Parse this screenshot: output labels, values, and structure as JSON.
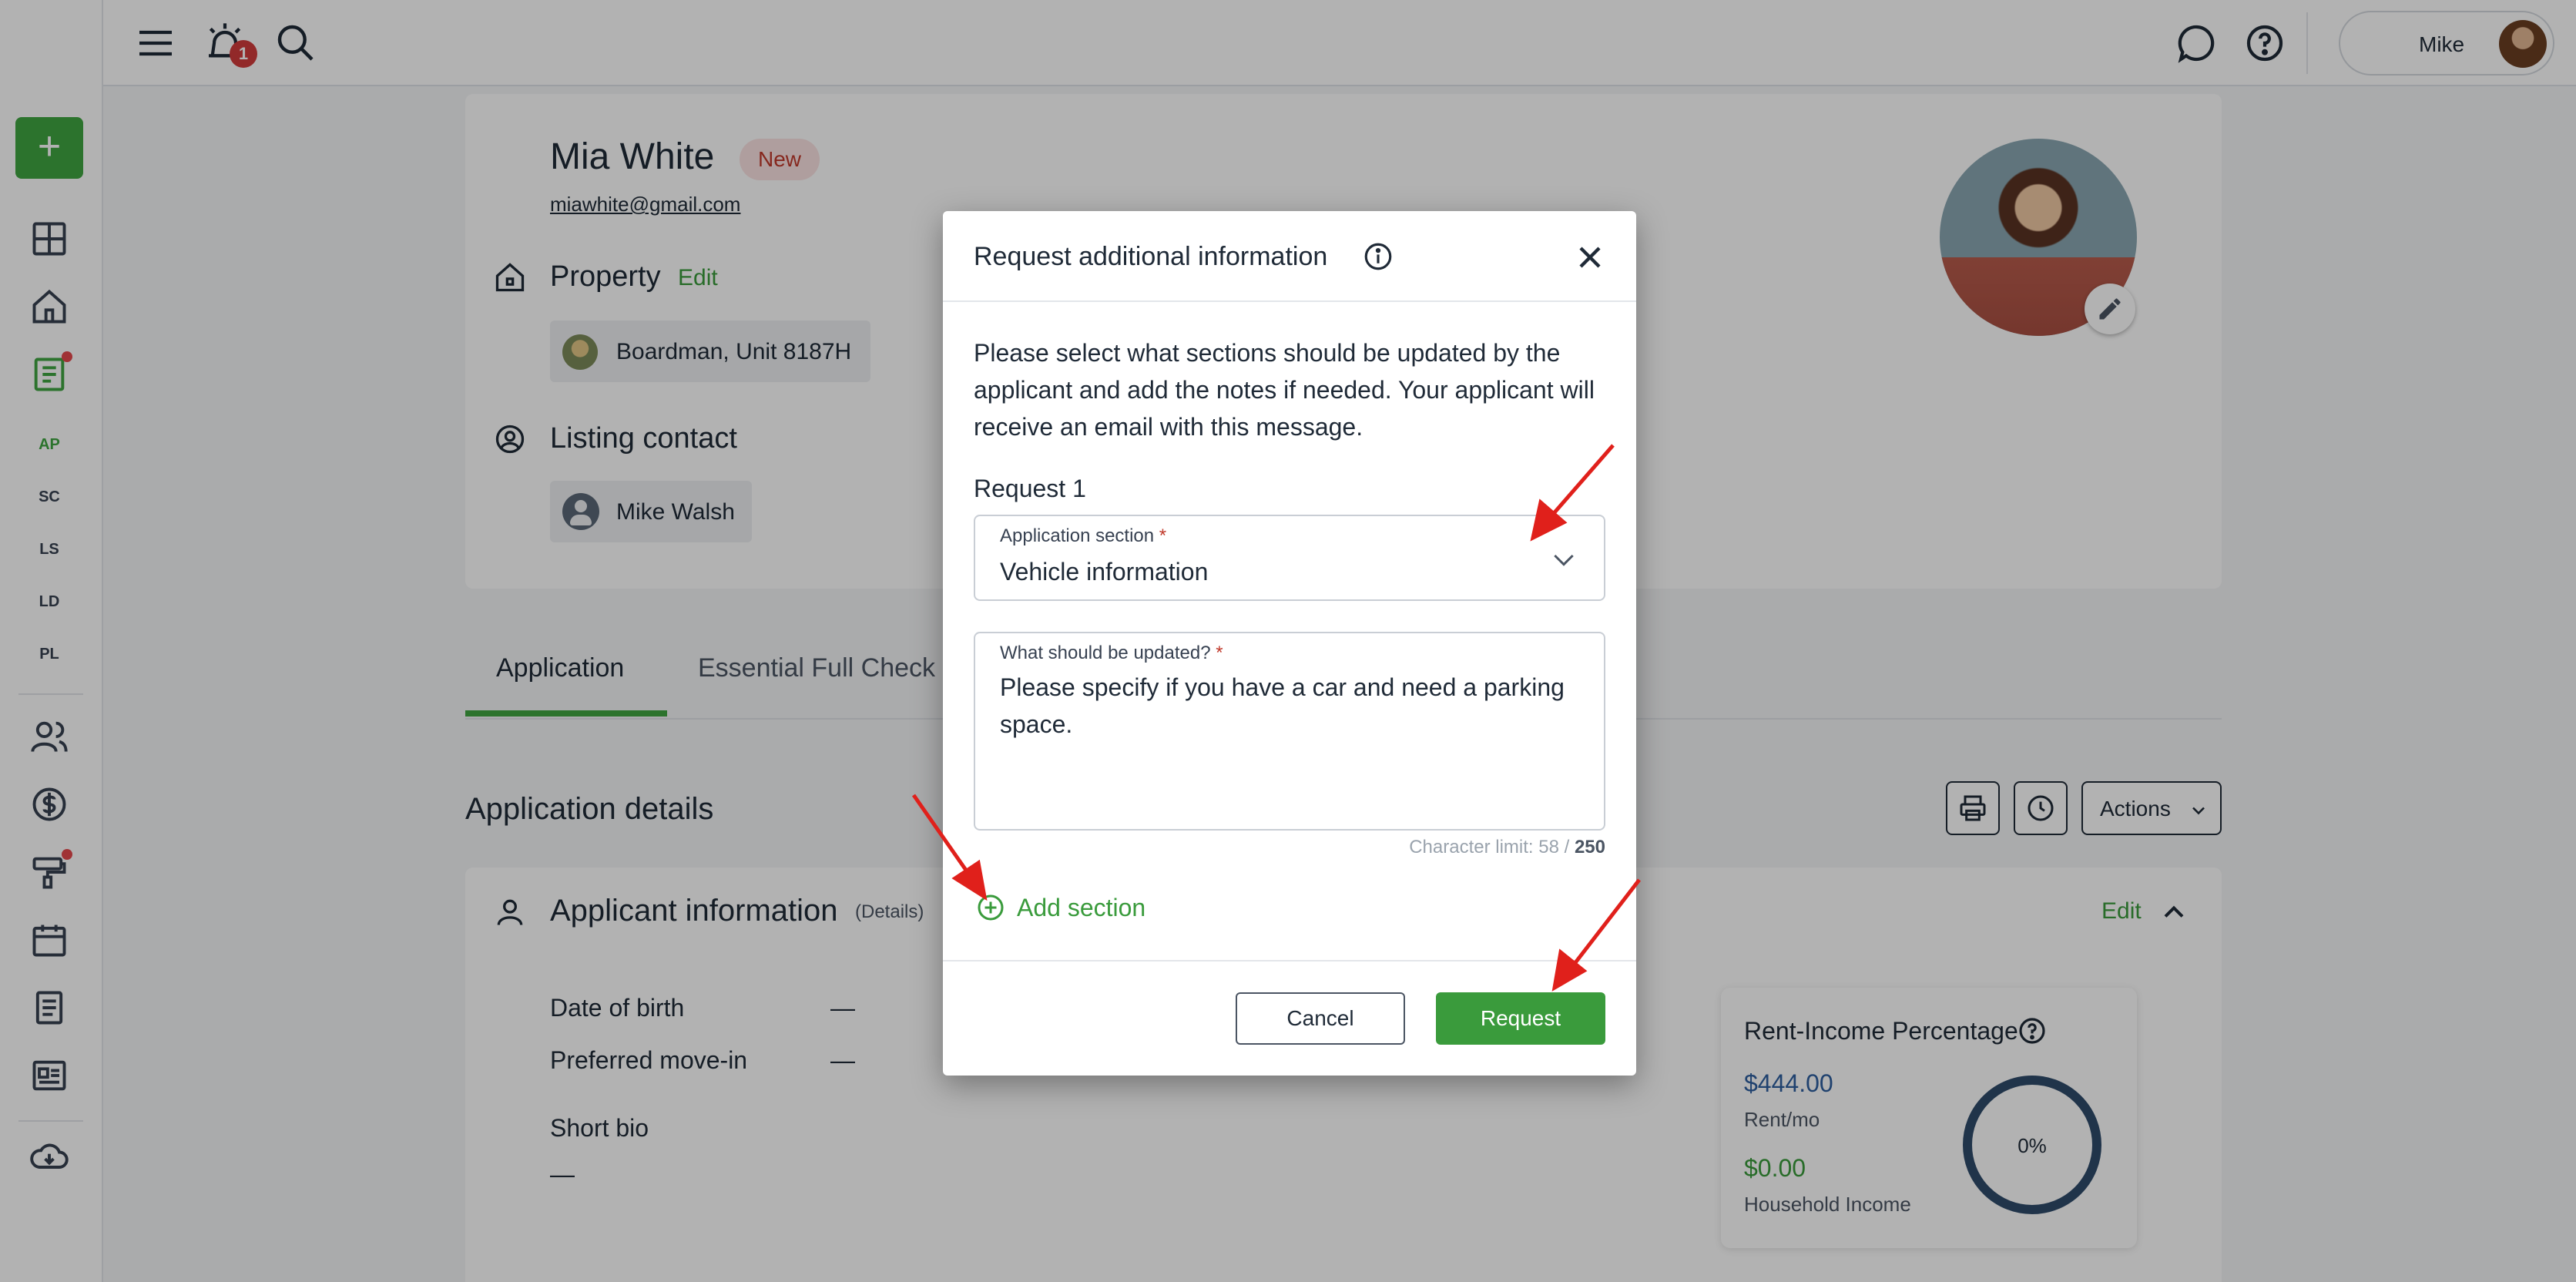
{
  "header": {
    "notification_count": "1",
    "user_name": "Mike"
  },
  "sidebar": {
    "add_label": "+",
    "sub_items": [
      "AP",
      "SC",
      "LS",
      "LD",
      "PL"
    ]
  },
  "profile": {
    "name": "Mia White",
    "status": "New",
    "email": "miawhite@gmail.com",
    "property_title": "Property",
    "property_edit": "Edit",
    "property_name": "Boardman, Unit 8187H",
    "listing_contact_title": "Listing contact",
    "listing_contact_name": "Mike Walsh"
  },
  "tabs": [
    {
      "label": "Application",
      "active": true
    },
    {
      "label": "Essential Full Check",
      "active": false
    }
  ],
  "application_details": {
    "title": "Application details",
    "actions_label": "Actions",
    "applicant_title": "Applicant information",
    "applicant_sub": "(Details)",
    "edit_label": "Edit",
    "rows": [
      {
        "label": "Date of birth",
        "value": "—"
      },
      {
        "label": "Preferred move-in",
        "value": "—"
      }
    ],
    "short_bio_label": "Short bio",
    "short_bio_value": "—"
  },
  "rent_income": {
    "title": "Rent-Income Percentage",
    "rent_value": "$444.00",
    "rent_label": "Rent/mo",
    "income_value": "$0.00",
    "income_label": "Household Income",
    "percentage": "0%"
  },
  "modal": {
    "title": "Request additional information",
    "description": "Please select what sections should be updated by the applicant and add the notes if needed. Your applicant will receive an email with this message.",
    "request_label": "Request 1",
    "section_field_label": "Application section",
    "section_field_value": "Vehicle information",
    "update_field_label": "What should be updated?",
    "update_field_value": "Please specify if you have a car and need a parking space.",
    "char_limit_label": "Character limit: 58 / ",
    "char_limit_max": "250",
    "required_mark": "*",
    "add_section_label": "Add section",
    "cancel_label": "Cancel",
    "request_button_label": "Request"
  },
  "colors": {
    "brand_green": "#3fa541",
    "badge_red": "#d23b3b",
    "annotation_arrow": "#e0201b"
  }
}
